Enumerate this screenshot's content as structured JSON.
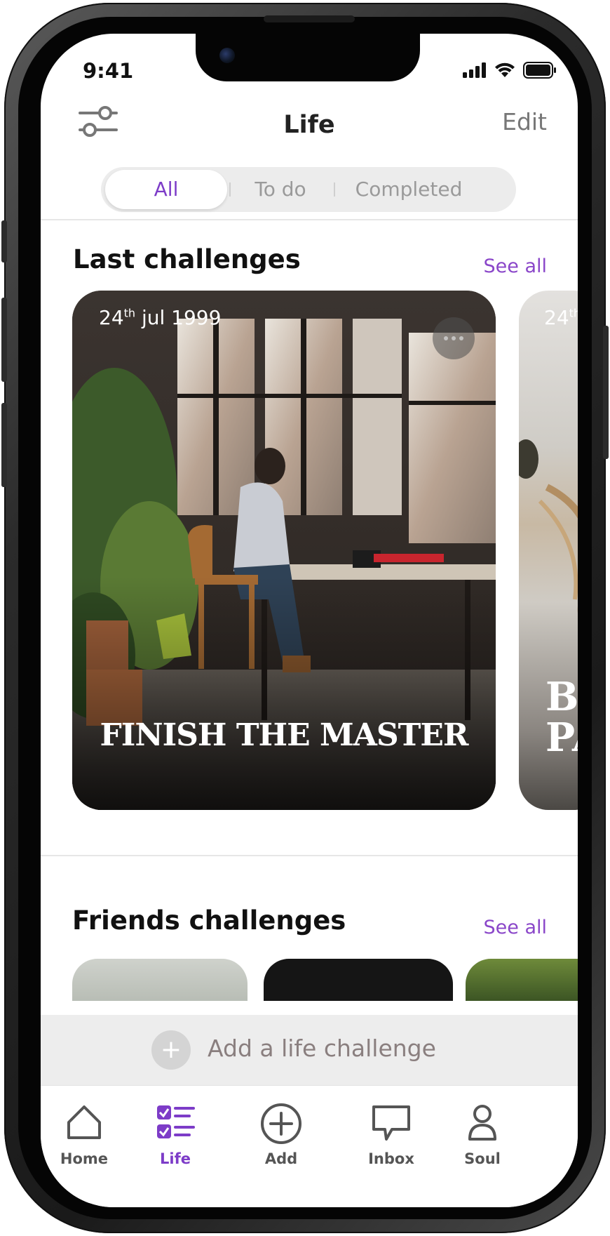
{
  "status_bar": {
    "time": "9:41"
  },
  "header": {
    "title": "Life",
    "edit_label": "Edit",
    "filter_icon": "sliders-icon"
  },
  "segmented": {
    "options": [
      "All",
      "To do",
      "Completed"
    ],
    "selected": "All"
  },
  "last_challenges": {
    "title": "Last challenges",
    "see_all": "See all",
    "cards": [
      {
        "date_day": "24",
        "date_suffix": "th",
        "date_rest": " jul 1999",
        "title": "FINISH THE MASTER"
      },
      {
        "date_day": "24",
        "date_suffix": "th",
        "title_line1": "BI",
        "title_line2": "PA"
      }
    ]
  },
  "friends_challenges": {
    "title": "Friends challenges",
    "see_all": "See all"
  },
  "add_bar": {
    "label": "Add a life challenge"
  },
  "tabbar": {
    "items": [
      {
        "label": "Home",
        "icon": "home-icon"
      },
      {
        "label": "Life",
        "icon": "checklist-icon",
        "active": true
      },
      {
        "label": "Add",
        "icon": "plus-circle-icon"
      },
      {
        "label": "Inbox",
        "icon": "chat-bubble-icon"
      },
      {
        "label": "Soul",
        "icon": "person-icon"
      }
    ]
  },
  "colors": {
    "accent": "#7d3cc8",
    "see_all": "#8a46c9",
    "segment_bg": "#ececec",
    "add_bar_bg": "#ededed"
  }
}
